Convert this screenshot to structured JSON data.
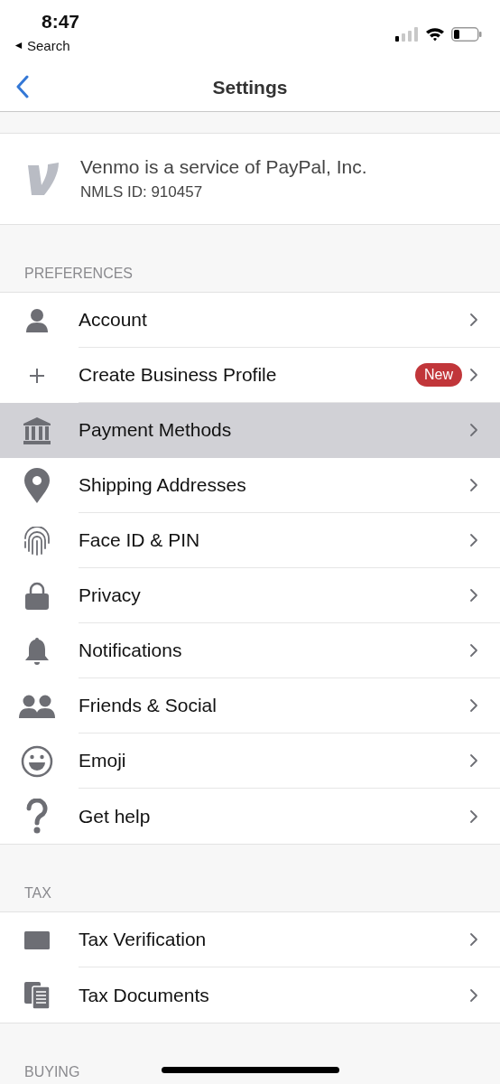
{
  "status_bar": {
    "time": "8:47",
    "back_app": "Search"
  },
  "nav": {
    "title": "Settings"
  },
  "info": {
    "title": "Venmo is a service of PayPal, Inc.",
    "subtitle": "NMLS ID: 910457"
  },
  "sections": [
    {
      "header": "PREFERENCES",
      "items": [
        {
          "kind": "person",
          "label": "Account",
          "selected": false
        },
        {
          "kind": "plus",
          "label": "Create Business Profile",
          "badge": "New",
          "selected": false
        },
        {
          "kind": "bank",
          "label": "Payment Methods",
          "selected": true
        },
        {
          "kind": "pin",
          "label": "Shipping Addresses",
          "selected": false
        },
        {
          "kind": "fingerprint",
          "label": "Face ID & PIN",
          "selected": false
        },
        {
          "kind": "lock",
          "label": "Privacy",
          "selected": false
        },
        {
          "kind": "bell",
          "label": "Notifications",
          "selected": false
        },
        {
          "kind": "people",
          "label": "Friends & Social",
          "selected": false
        },
        {
          "kind": "smiley",
          "label": "Emoji",
          "selected": false
        },
        {
          "kind": "question",
          "label": "Get help",
          "selected": false
        }
      ]
    },
    {
      "header": "TAX",
      "items": [
        {
          "kind": "card",
          "label": "Tax Verification",
          "selected": false
        },
        {
          "kind": "documents",
          "label": "Tax Documents",
          "selected": false
        }
      ]
    },
    {
      "header": "BUYING"
    }
  ]
}
